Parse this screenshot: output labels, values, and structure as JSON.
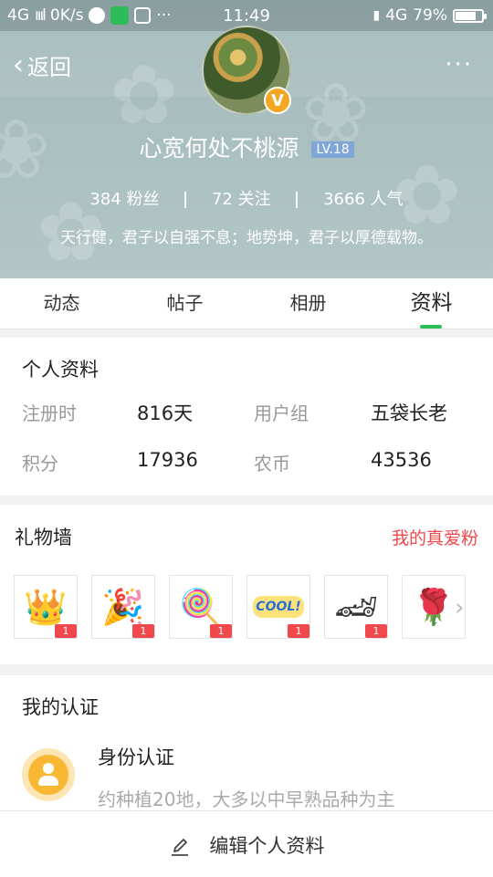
{
  "status_bar": {
    "network": "4G",
    "speed": "0K/s",
    "time": "11:49",
    "network_right": "4G",
    "battery": "79%",
    "battery_level": 0.79
  },
  "nav": {
    "back_label": "返回",
    "more_label": "···"
  },
  "profile": {
    "name": "心宽何处不桃源",
    "level": "LV.18",
    "badge": "V",
    "fans": "384 粉丝",
    "follows": "72 关注",
    "popularity": "3666 人气",
    "motto": "天行健，君子以自强不息；地势坤，君子以厚德载物。"
  },
  "tabs": [
    {
      "label": "动态"
    },
    {
      "label": "帖子"
    },
    {
      "label": "相册"
    },
    {
      "label": "资料"
    }
  ],
  "info": {
    "title": "个人资料",
    "register_label": "注册时",
    "register_value": "816天",
    "group_label": "用户组",
    "group_value": "五袋长老",
    "points_label": "积分",
    "points_value": "17936",
    "coins_label": "农币",
    "coins_value": "43536"
  },
  "gifts": {
    "title": "礼物墙",
    "link": "我的真爱粉",
    "items": [
      {
        "icon": "crown-icon",
        "glyph": "👑",
        "count": "1"
      },
      {
        "icon": "party-popper-icon",
        "glyph": "🎉",
        "count": "1"
      },
      {
        "icon": "lollipop-icon",
        "glyph": "🍭",
        "count": "1"
      },
      {
        "icon": "cool-sticker-icon",
        "glyph": "COOL!",
        "count": "1"
      },
      {
        "icon": "sports-car-icon",
        "glyph": "🏎",
        "count": "1"
      },
      {
        "icon": "rose-icon",
        "glyph": "🌹",
        "count": ""
      }
    ]
  },
  "certification": {
    "title": "我的认证",
    "item_title": "身份认证",
    "item_desc": "约种植20地，大多以中早熟品种为主"
  },
  "bottom": {
    "edit_label": "编辑个人资料"
  },
  "colors": {
    "accent_green": "#2dbc5a",
    "link_red": "#f0484c",
    "badge_orange": "#f5a623",
    "level_blue": "#7fa6d6"
  }
}
